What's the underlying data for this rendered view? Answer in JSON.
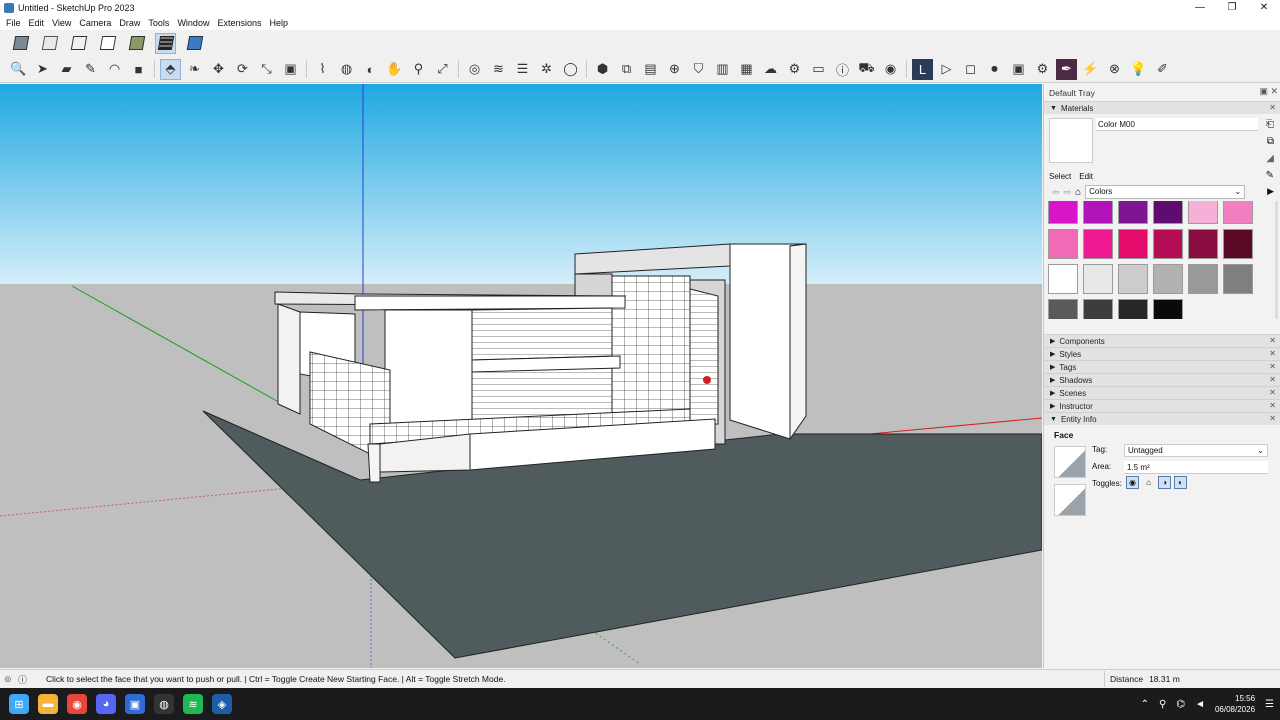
{
  "window": {
    "title": "Untitled - SketchUp Pro 2023",
    "controls": [
      "—",
      "❐",
      "✕"
    ]
  },
  "menu": [
    "File",
    "Edit",
    "View",
    "Camera",
    "Draw",
    "Tools",
    "Window",
    "Extensions",
    "Help"
  ],
  "styles_toolbar": [
    "xray-style",
    "back-edges-style",
    "wireframe-style",
    "hidden-line-style",
    "shaded-style",
    "shaded-textures-style",
    "monochrome-style"
  ],
  "tools": {
    "group1": [
      {
        "name": "zoom-extents",
        "glyph": "🔍"
      },
      {
        "name": "select",
        "glyph": "➤"
      },
      {
        "name": "eraser",
        "glyph": "▰"
      },
      {
        "name": "line",
        "glyph": "✎"
      },
      {
        "name": "arc",
        "glyph": "◠"
      },
      {
        "name": "rectangle",
        "glyph": "■"
      }
    ],
    "group2": [
      {
        "name": "push-pull",
        "glyph": "⬘"
      },
      {
        "name": "offset",
        "glyph": "❧"
      },
      {
        "name": "move",
        "glyph": "✥"
      },
      {
        "name": "rotate",
        "glyph": "⟳"
      },
      {
        "name": "scale",
        "glyph": "⤡"
      },
      {
        "name": "follow-me",
        "glyph": "▣"
      }
    ],
    "group3": [
      {
        "name": "tape-measure",
        "glyph": "⌇"
      },
      {
        "name": "paint-bucket",
        "glyph": "◍"
      },
      {
        "name": "orbit",
        "glyph": "◐"
      },
      {
        "name": "pan",
        "glyph": "✋"
      },
      {
        "name": "zoom",
        "glyph": "⚲"
      },
      {
        "name": "zoom-window",
        "glyph": "⤢"
      }
    ],
    "group4": [
      {
        "name": "section-plane",
        "glyph": "◎"
      },
      {
        "name": "sandbox",
        "glyph": "≋"
      },
      {
        "name": "layers",
        "glyph": "☰"
      },
      {
        "name": "solid-tools",
        "glyph": "✲"
      },
      {
        "name": "account",
        "glyph": "◯"
      }
    ],
    "group5": [
      {
        "name": "components",
        "glyph": "⬢"
      },
      {
        "name": "scale-view",
        "glyph": "⧉"
      },
      {
        "name": "camera-view",
        "glyph": "▤"
      },
      {
        "name": "add-location",
        "glyph": "⊕"
      },
      {
        "name": "3d-warehouse",
        "glyph": "⛉"
      },
      {
        "name": "extension-warehouse",
        "glyph": "▥"
      },
      {
        "name": "checker",
        "glyph": "▦"
      },
      {
        "name": "cloud",
        "glyph": "☁"
      },
      {
        "name": "extensions",
        "glyph": "⚙"
      },
      {
        "name": "folder",
        "glyph": "▭"
      },
      {
        "name": "info",
        "glyph": "ⓘ"
      },
      {
        "name": "cart",
        "glyph": "⛟"
      },
      {
        "name": "profile",
        "glyph": "◉"
      }
    ],
    "group6": [
      {
        "name": "layout",
        "glyph": "L"
      },
      {
        "name": "play",
        "glyph": "▷"
      },
      {
        "name": "stop",
        "glyph": "◻"
      },
      {
        "name": "record",
        "glyph": "⏺"
      },
      {
        "name": "movie",
        "glyph": "▣"
      },
      {
        "name": "settings",
        "glyph": "⚙"
      },
      {
        "name": "pen-extension",
        "glyph": "✒"
      },
      {
        "name": "lightning",
        "glyph": "⚡"
      },
      {
        "name": "cancel",
        "glyph": "⊗"
      },
      {
        "name": "bulb",
        "glyph": "💡"
      },
      {
        "name": "draw",
        "glyph": "✐"
      }
    ]
  },
  "tray": {
    "title": "Default Tray",
    "materials": {
      "label": "Materials",
      "material_name": "Color M00",
      "tabs": [
        "Select",
        "Edit"
      ],
      "library": "Colors",
      "swatches": [
        [
          "#d815c8",
          "#b214b9",
          "#7e1591",
          "#5e0c6e",
          "#f5b0d8",
          "#f37ec0"
        ],
        [
          "#f06ab5",
          "#ef1a93",
          "#e50d6c",
          "#b30e55",
          "#8a0b3f",
          "#5b0826"
        ],
        [
          "#ffffff",
          "#e8e8e8",
          "#cccccc",
          "#b1b1b1",
          "#999999",
          "#7f7f7f"
        ],
        [
          "#5a5a5a",
          "#3d3d3d",
          "#262626",
          "#0a0a0a"
        ]
      ]
    },
    "panels": [
      "Components",
      "Styles",
      "Tags",
      "Shadows",
      "Scenes",
      "Instructor",
      "Entity Info"
    ],
    "entity_info": {
      "type": "Face",
      "tag_label": "Tag:",
      "tag_value": "Untagged",
      "area_label": "Area:",
      "area_value": "1.5 m²",
      "toggles_label": "Toggles:"
    }
  },
  "status": {
    "message": "Click to select the face that you want to push or pull. | Ctrl = Toggle Create New Starting Face. | Alt = Toggle Stretch Mode.",
    "measurement_label": "Distance",
    "measurement_value": "18.31 m"
  },
  "taskbar": {
    "apps": [
      {
        "name": "windows-start",
        "glyph": "⊞",
        "color": "#3fa9f5"
      },
      {
        "name": "file-explorer",
        "glyph": "▬",
        "color": "#f2b53a"
      },
      {
        "name": "chrome",
        "glyph": "◉",
        "color": "#e8453c"
      },
      {
        "name": "discord",
        "glyph": "◕",
        "color": "#5865f2"
      },
      {
        "name": "task-app",
        "glyph": "▣",
        "color": "#2f6bd8"
      },
      {
        "name": "github",
        "glyph": "◍",
        "color": "#333333"
      },
      {
        "name": "spotify",
        "glyph": "≋",
        "color": "#1db954"
      },
      {
        "name": "sketchup",
        "glyph": "◈",
        "color": "#1c5fa8"
      }
    ],
    "time": "15:56",
    "date": "06/08/2026"
  }
}
